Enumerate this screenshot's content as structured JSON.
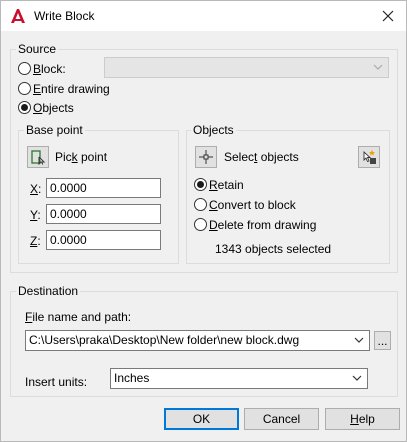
{
  "window": {
    "title": "Write Block"
  },
  "source": {
    "legend": "Source",
    "options": {
      "block": {
        "access": "B",
        "rest": "lock:",
        "selected": false
      },
      "entire_drawing": {
        "access": "E",
        "rest": "ntire drawing",
        "selected": false
      },
      "objects": {
        "access": "O",
        "rest": "bjects",
        "selected": true
      }
    },
    "block_select_value": ""
  },
  "base_point": {
    "legend": "Base point",
    "pick_point": {
      "pre": "Pic",
      "access": "k",
      "post": " point"
    },
    "fields": [
      {
        "access": "X",
        "suffix": ":",
        "value": "0.0000"
      },
      {
        "access": "Y",
        "suffix": ":",
        "value": "0.0000"
      },
      {
        "access": "Z",
        "suffix": ":",
        "value": "0.0000"
      }
    ]
  },
  "objects": {
    "legend": "Objects",
    "select_objects": {
      "pre": "Selec",
      "access": "t",
      "post": " objects"
    },
    "options": {
      "retain": {
        "access": "R",
        "rest": "etain",
        "selected": true
      },
      "convert": {
        "access": "C",
        "rest": "onvert to block",
        "selected": false
      },
      "delete": {
        "access": "D",
        "rest": "elete from drawing",
        "selected": false
      }
    },
    "status": "1343 objects selected"
  },
  "destination": {
    "legend": "Destination",
    "file_label": {
      "access": "F",
      "rest": "ile name and path:"
    },
    "file_path": "C:\\Users\\praka\\Desktop\\New folder\\new block.dwg",
    "browse_label": "...",
    "insert_units_label": "Insert units:",
    "insert_units_value": "Inches"
  },
  "buttons": {
    "ok": "OK",
    "cancel": "Cancel",
    "help": {
      "access": "H",
      "rest": "elp"
    }
  },
  "colors": {
    "accent": "#0078d7",
    "app_icon": "#c8102e"
  }
}
